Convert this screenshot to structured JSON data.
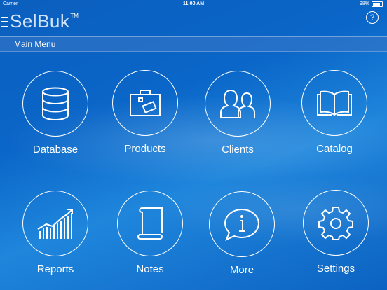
{
  "status": {
    "carrier": "Carrier",
    "time": "11:00 AM",
    "battery": "98%"
  },
  "header": {
    "logo": "SelBuk",
    "trademark": "TM",
    "help": "?"
  },
  "section": {
    "title": "Main Menu"
  },
  "tiles": [
    {
      "label": "Database",
      "icon": "database-icon"
    },
    {
      "label": "Products",
      "icon": "briefcase-icon"
    },
    {
      "label": "Clients",
      "icon": "users-icon"
    },
    {
      "label": "Catalog",
      "icon": "open-book-icon"
    },
    {
      "label": "Reports",
      "icon": "bar-chart-icon"
    },
    {
      "label": "Notes",
      "icon": "scroll-note-icon"
    },
    {
      "label": "More",
      "icon": "info-bubble-icon"
    },
    {
      "label": "Settings",
      "icon": "gear-icon"
    }
  ]
}
